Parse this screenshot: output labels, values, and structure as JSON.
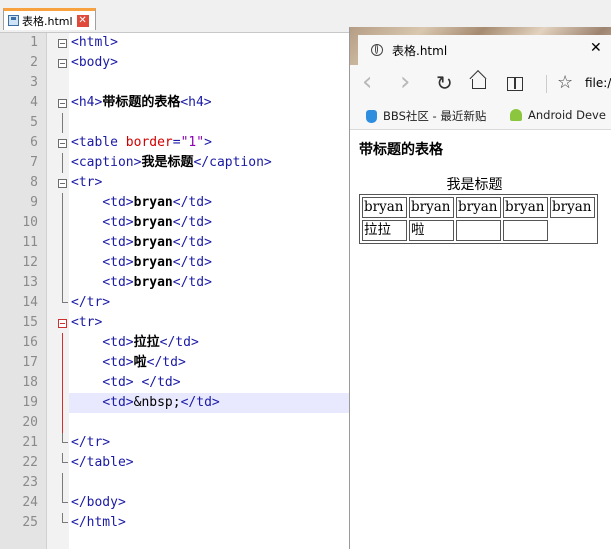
{
  "editor": {
    "tab_label": "表格.html",
    "tab_close": "✕",
    "lines": [
      {
        "n": "1",
        "segs": [
          [
            "tag",
            "<html>"
          ]
        ]
      },
      {
        "n": "2",
        "segs": [
          [
            "tag",
            "<body>"
          ]
        ]
      },
      {
        "n": "3",
        "segs": []
      },
      {
        "n": "4",
        "segs": [
          [
            "tag",
            "<h4>"
          ],
          [
            "b",
            "带标题的表格"
          ],
          [
            "tag",
            "<h4>"
          ]
        ]
      },
      {
        "n": "5",
        "segs": []
      },
      {
        "n": "6",
        "segs": [
          [
            "tag",
            "<table "
          ],
          [
            "attr",
            "border"
          ],
          [
            "tag",
            "="
          ],
          [
            "val",
            "\"1\""
          ],
          [
            "tag",
            ">"
          ]
        ]
      },
      {
        "n": "7",
        "segs": [
          [
            "tag",
            "<caption>"
          ],
          [
            "b",
            "我是标题"
          ],
          [
            "tag",
            "</caption>"
          ]
        ]
      },
      {
        "n": "8",
        "segs": [
          [
            "tag",
            "<tr>"
          ]
        ]
      },
      {
        "n": "9",
        "segs": [
          [
            "plain",
            "    "
          ],
          [
            "tag",
            "<td>"
          ],
          [
            "b",
            "bryan"
          ],
          [
            "tag",
            "</td>"
          ]
        ]
      },
      {
        "n": "10",
        "segs": [
          [
            "plain",
            "    "
          ],
          [
            "tag",
            "<td>"
          ],
          [
            "b",
            "bryan"
          ],
          [
            "tag",
            "</td>"
          ]
        ]
      },
      {
        "n": "11",
        "segs": [
          [
            "plain",
            "    "
          ],
          [
            "tag",
            "<td>"
          ],
          [
            "b",
            "bryan"
          ],
          [
            "tag",
            "</td>"
          ]
        ]
      },
      {
        "n": "12",
        "segs": [
          [
            "plain",
            "    "
          ],
          [
            "tag",
            "<td>"
          ],
          [
            "b",
            "bryan"
          ],
          [
            "tag",
            "</td>"
          ]
        ]
      },
      {
        "n": "13",
        "segs": [
          [
            "plain",
            "    "
          ],
          [
            "tag",
            "<td>"
          ],
          [
            "b",
            "bryan"
          ],
          [
            "tag",
            "</td>"
          ]
        ]
      },
      {
        "n": "14",
        "segs": [
          [
            "tag",
            "</tr>"
          ]
        ]
      },
      {
        "n": "15",
        "segs": [
          [
            "tag",
            "<tr>"
          ]
        ]
      },
      {
        "n": "16",
        "segs": [
          [
            "plain",
            "    "
          ],
          [
            "tag",
            "<td>"
          ],
          [
            "b",
            "拉拉"
          ],
          [
            "tag",
            "</td>"
          ]
        ]
      },
      {
        "n": "17",
        "segs": [
          [
            "plain",
            "    "
          ],
          [
            "tag",
            "<td>"
          ],
          [
            "b",
            "啦"
          ],
          [
            "tag",
            "</td>"
          ]
        ]
      },
      {
        "n": "18",
        "segs": [
          [
            "plain",
            "    "
          ],
          [
            "tag",
            "<td> </td>"
          ]
        ]
      },
      {
        "n": "19",
        "segs": [
          [
            "plain",
            "    "
          ],
          [
            "tag",
            "<td>"
          ],
          [
            "plain",
            "&nbsp;"
          ],
          [
            "tag",
            "</td>"
          ]
        ]
      },
      {
        "n": "20",
        "segs": []
      },
      {
        "n": "21",
        "segs": [
          [
            "tag",
            "</tr>"
          ]
        ]
      },
      {
        "n": "22",
        "segs": [
          [
            "tag",
            "</table>"
          ]
        ]
      },
      {
        "n": "23",
        "segs": []
      },
      {
        "n": "24",
        "segs": [
          [
            "tag",
            "</body>"
          ]
        ]
      },
      {
        "n": "25",
        "segs": [
          [
            "tag",
            "</html>"
          ]
        ]
      }
    ]
  },
  "browser": {
    "tab_title": "表格.html",
    "tab_close": "✕",
    "address": "file:/",
    "nav": {
      "back": "‹",
      "forward": "›",
      "refresh": "↻",
      "favorite": "☆"
    },
    "favorites": [
      {
        "label": "BBS社区 - 最近新贴",
        "icon": "bbs-icon"
      },
      {
        "label": "Android Deve",
        "icon": "android-icon"
      }
    ],
    "page": {
      "heading": "带标题的表格",
      "caption": "我是标题",
      "rows": [
        [
          "bryan",
          "bryan",
          "bryan",
          "bryan",
          "bryan"
        ],
        [
          "拉拉",
          "啦",
          "",
          ""
        ]
      ]
    }
  },
  "colors": {
    "tag": "#1a1aa6",
    "attr": "#d00000",
    "value": "#8a00b0",
    "tab_accent": "#f7a23f",
    "fold_marker": "#d03030"
  }
}
